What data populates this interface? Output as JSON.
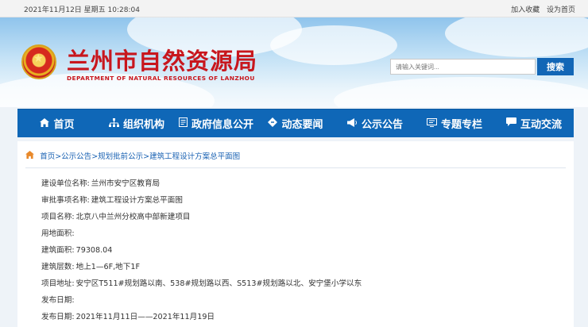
{
  "topbar": {
    "date": "2021年11月12日  星期五  10:28:04",
    "favorites": "加入收藏",
    "homepage": "设为首页"
  },
  "header": {
    "title": "兰州市自然资源局",
    "subtitle": "DEPARTMENT OF NATURAL RESOURCES OF LANZHOU",
    "search_placeholder": "请输入关键词...",
    "search_button": "搜索"
  },
  "nav": [
    {
      "label": "首页",
      "icon": "home-icon"
    },
    {
      "label": "组织机构",
      "icon": "org-icon"
    },
    {
      "label": "政府信息公开",
      "icon": "document-icon"
    },
    {
      "label": "动态要闻",
      "icon": "news-icon"
    },
    {
      "label": "公示公告",
      "icon": "megaphone-icon"
    },
    {
      "label": "专题专栏",
      "icon": "column-icon"
    },
    {
      "label": "互动交流",
      "icon": "chat-icon"
    }
  ],
  "breadcrumb": {
    "items": [
      "首页",
      "公示公告",
      "规划批前公示",
      "建筑工程设计方案总平面图"
    ],
    "separator": ">"
  },
  "fields": [
    {
      "label": "建设单位名称:",
      "value": "兰州市安宁区教育局"
    },
    {
      "label": "审批事项名称:",
      "value": "建筑工程设计方案总平面图"
    },
    {
      "label": "项目名称:",
      "value": "北京八中兰州分校高中部新建项目"
    },
    {
      "label": "用地面积:",
      "value": ""
    },
    {
      "label": "建筑面积:",
      "value": "79308.04"
    },
    {
      "label": "建筑层数:",
      "value": "地上1—6F,地下1F"
    },
    {
      "label": "项目地址:",
      "value": "安宁区T511#规划路以南、538#规划路以西、S513#规划路以北、安宁堡小学以东"
    },
    {
      "label": "发布日期:",
      "value": ""
    },
    {
      "label": "发布日期:",
      "value": "2021年11月11日——2021年11月19日"
    }
  ],
  "colors": {
    "nav_bg": "#0f67b7",
    "title_red": "#c8161d",
    "link_blue": "#1a62b3"
  }
}
